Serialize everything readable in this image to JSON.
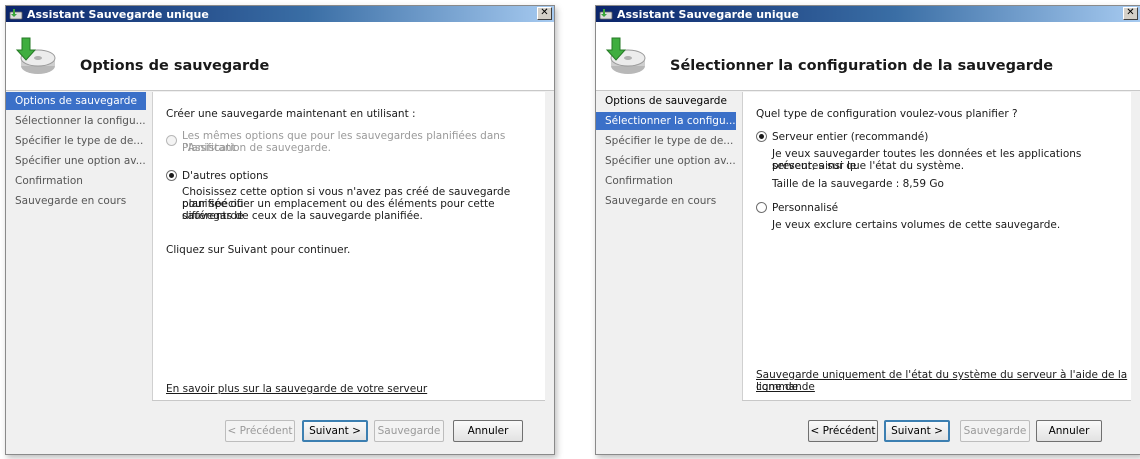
{
  "left_window": {
    "title": "Assistant Sauvegarde unique",
    "header_title": "Options de sauvegarde",
    "nav": [
      {
        "label": "Options de sauvegarde",
        "state": "active"
      },
      {
        "label": "Sélectionner la configu...",
        "state": "pending"
      },
      {
        "label": "Spécifier le type de de...",
        "state": "pending"
      },
      {
        "label": "Spécifier une option av...",
        "state": "pending"
      },
      {
        "label": "Confirmation",
        "state": "pending"
      },
      {
        "label": "Sauvegarde en cours",
        "state": "pending"
      }
    ],
    "intro": "Créer une sauvegarde maintenant en utilisant :",
    "option_same": {
      "line1": "Les mêmes options que pour les sauvegardes planifiées dans l'Assistant",
      "line2": "Planification de sauvegarde.",
      "selected": false,
      "enabled": false
    },
    "option_other": {
      "label": "D'autres options",
      "desc1": "Choisissez cette option si vous n'avez pas créé de sauvegarde planifiée ou",
      "desc2": "pour spécifier un emplacement ou des éléments pour cette sauvegarde",
      "desc3": "différents de ceux de la sauvegarde planifiée.",
      "selected": true
    },
    "continue_text": "Cliquez sur Suivant pour continuer.",
    "learn_more_link": "En savoir plus sur la sauvegarde de votre serveur",
    "buttons": {
      "previous": "< Précédent",
      "next": "Suivant >",
      "backup": "Sauvegarde",
      "cancel": "Annuler"
    }
  },
  "right_window": {
    "title": "Assistant Sauvegarde unique",
    "header_title": "Sélectionner la configuration de la sauvegarde",
    "nav": [
      {
        "label": "Options de sauvegarde",
        "state": "done"
      },
      {
        "label": "Sélectionner la configu...",
        "state": "active"
      },
      {
        "label": "Spécifier le type de de...",
        "state": "pending"
      },
      {
        "label": "Spécifier une option av...",
        "state": "pending"
      },
      {
        "label": "Confirmation",
        "state": "pending"
      },
      {
        "label": "Sauvegarde en cours",
        "state": "pending"
      }
    ],
    "question": "Quel type de configuration voulez-vous planifier ?",
    "option_full": {
      "label": "Serveur entier (recommandé)",
      "desc1": "Je veux sauvegarder toutes les données et les applications présentes sur le",
      "desc2": "serveur, ainsi que l'état du système.",
      "size": "Taille de la sauvegarde : 8,59 Go",
      "selected": true
    },
    "option_custom": {
      "label": "Personnalisé",
      "desc": "Je veux exclure certains volumes de cette sauvegarde.",
      "selected": false
    },
    "system_state_link_1": "Sauvegarde uniquement de l'état du système du serveur à l'aide de la ligne de",
    "system_state_link_2": "commande",
    "buttons": {
      "previous": "< Précédent",
      "next": "Suivant >",
      "backup": "Sauvegarde",
      "cancel": "Annuler"
    }
  },
  "icons": {
    "app": "backup-app-icon",
    "header": "backup-disk-arrow-icon",
    "close": "close-icon"
  },
  "colors": {
    "title_start": "#0a246a",
    "title_end": "#a6caf0",
    "nav_active": "#3b70c8",
    "link": "#0033cc"
  }
}
